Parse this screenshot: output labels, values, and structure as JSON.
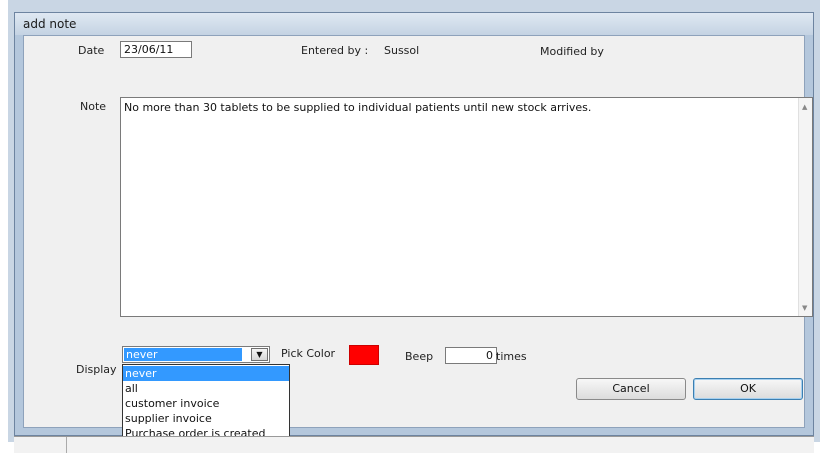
{
  "window": {
    "title": "add note"
  },
  "form": {
    "date_label": "Date",
    "date_value": "23/06/11",
    "entered_by_label": "Entered by :",
    "entered_by_value": "Sussol",
    "modified_by_label": "Modified by",
    "note_label": "Note",
    "note_text": "No more than 30 tablets to be supplied to individual patients until new stock arrives.",
    "display_label": "Display",
    "display_selected": "never",
    "display_options": [
      "never",
      "all",
      "customer invoice",
      "supplier invoice",
      "Purchase order is created"
    ],
    "pick_color_label": "Pick Color",
    "pick_color_value": "#ff0000",
    "beep_label": "Beep",
    "beep_value": "0",
    "times_label": "times"
  },
  "buttons": {
    "cancel": "Cancel",
    "ok": "OK"
  },
  "icons": {
    "dropdown_arrow": "chevron-down-icon",
    "scroll_up": "scroll-up-icon",
    "scroll_down": "scroll-down-icon"
  }
}
